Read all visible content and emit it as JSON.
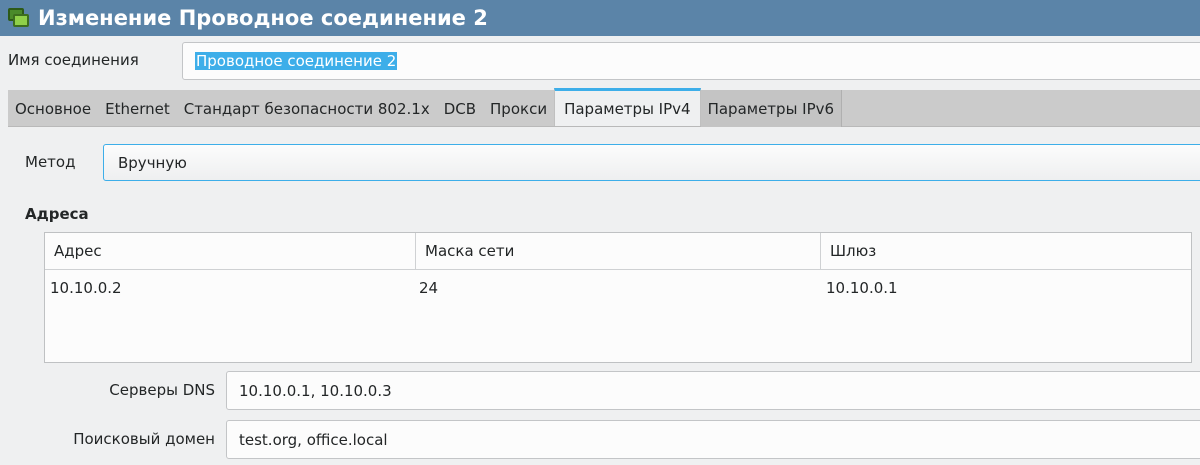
{
  "window": {
    "title": "Изменение Проводное соединение 2",
    "icon": "network-connections-icon"
  },
  "connection_name": {
    "label": "Имя соединения",
    "value": "Проводное соединение 2"
  },
  "tabs": [
    {
      "label": "Основное"
    },
    {
      "label": "Ethernet"
    },
    {
      "label": "Стандарт безопасности 802.1x"
    },
    {
      "label": "DCB"
    },
    {
      "label": "Прокси"
    },
    {
      "label": "Параметры IPv4",
      "active": true
    },
    {
      "label": "Параметры IPv6"
    }
  ],
  "ipv4": {
    "method": {
      "label": "Метод",
      "value": "Вручную"
    },
    "addresses": {
      "heading": "Адреса",
      "columns": [
        "Адрес",
        "Маска сети",
        "Шлюз"
      ],
      "rows": [
        [
          "10.10.0.2",
          "24",
          "10.10.0.1"
        ]
      ]
    },
    "dns": {
      "label": "Серверы DNS",
      "value": "10.10.0.1, 10.10.0.3"
    },
    "search_domain": {
      "label": "Поисковый домен",
      "value": "test.org, office.local"
    }
  },
  "colors": {
    "titlebar": "#5b84a8",
    "accent": "#3daee9"
  }
}
